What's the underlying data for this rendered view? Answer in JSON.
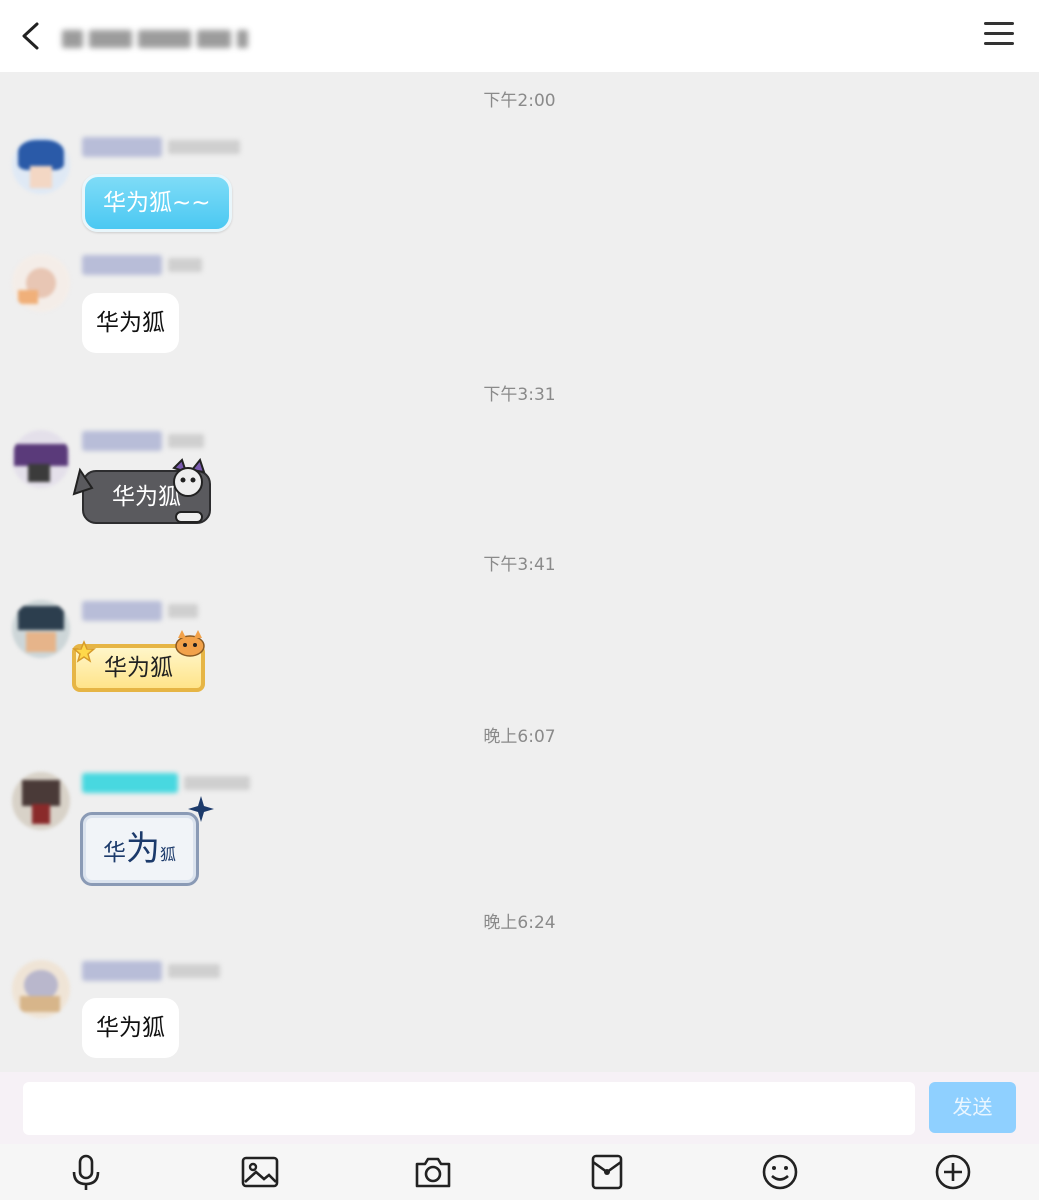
{
  "header": {
    "back_icon": "back-chevron-icon",
    "title": "",
    "menu_icon": "menu-icon"
  },
  "messages": [
    {
      "time": "下午2:00",
      "text": "华为狐~~",
      "style": "cyan"
    },
    {
      "time": "",
      "text": "华为狐",
      "style": "white"
    },
    {
      "time": "下午3:31",
      "text": "华为狐",
      "style": "cat"
    },
    {
      "time": "下午3:41",
      "text": "华为狐",
      "style": "gold"
    },
    {
      "time": "晚上6:07",
      "text_parts": [
        "华",
        "为",
        "狐"
      ],
      "style": "ink"
    },
    {
      "time": "晚上6:24",
      "text": "华为狐",
      "style": "white"
    }
  ],
  "input": {
    "placeholder": "",
    "value": "",
    "send_label": "发送"
  },
  "toolbar": {
    "icons": [
      "microphone-icon",
      "image-icon",
      "camera-icon",
      "red-packet-icon",
      "emoji-icon",
      "plus-icon"
    ]
  },
  "colors": {
    "send_button": "#8fd0ff",
    "cyan_bubble": "#4bc8f2",
    "background": "#efefef"
  }
}
